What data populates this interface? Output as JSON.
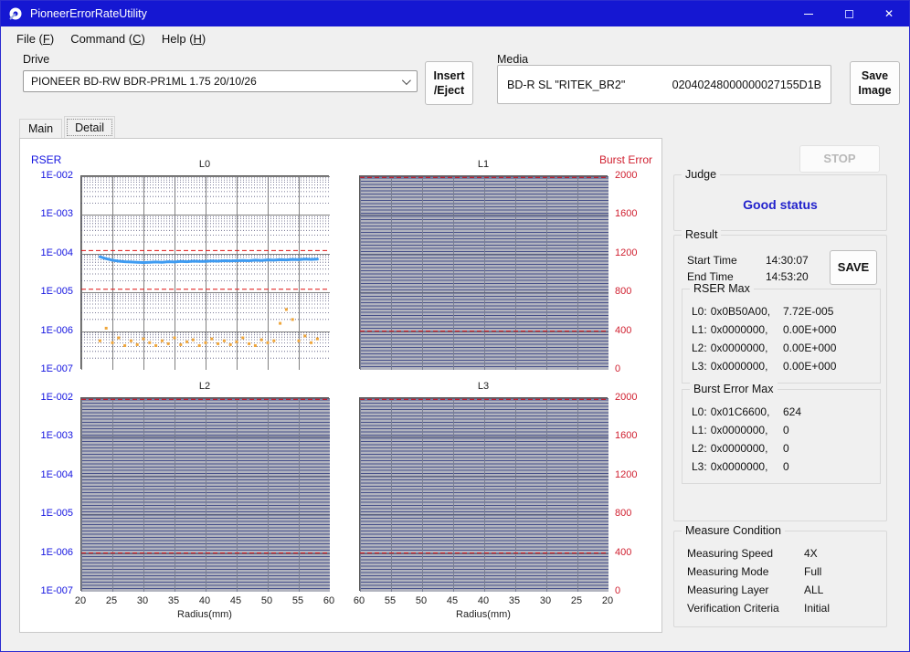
{
  "window": {
    "title": "PioneerErrorRateUtility"
  },
  "colors": {
    "titlebar": "#1517d2",
    "judge_status": "#2222cc",
    "axis_left": "#1414e0",
    "axis_right": "#d02030",
    "rser_line": "#3e9bf2",
    "burst_dots": "#efa63a",
    "threshold": "#e01010"
  },
  "menu": {
    "items": [
      {
        "pre": "File (",
        "key": "F",
        "post": ")"
      },
      {
        "pre": "Command (",
        "key": "C",
        "post": ")"
      },
      {
        "pre": "Help (",
        "key": "H",
        "post": ")"
      }
    ]
  },
  "drive": {
    "label": "Drive",
    "selected": "PIONEER BD-RW BDR-PR1ML 1.75 20/10/26"
  },
  "insert_eject": {
    "line1": "Insert",
    "line2": "/Eject"
  },
  "media": {
    "label": "Media",
    "disc": "BD-R SL \"RITEK_BR2\"",
    "id": "02040248000000027155D1B"
  },
  "save_image": {
    "line1": "Save",
    "line2": "Image"
  },
  "tabs": [
    {
      "label": "Main"
    },
    {
      "label": "Detail"
    }
  ],
  "stop_label": "STOP",
  "judge": {
    "label": "Judge",
    "status": "Good status"
  },
  "result": {
    "label": "Result",
    "start_time_label": "Start Time",
    "start_time": "14:30:07",
    "end_time_label": "End Time",
    "end_time": "14:53:20",
    "save_label": "SAVE",
    "rser_max": {
      "label": "RSER Max",
      "rows": [
        {
          "layer": "L0:",
          "address": "0x0B50A00,",
          "value": "7.72E-005"
        },
        {
          "layer": "L1:",
          "address": "0x0000000,",
          "value": "0.00E+000"
        },
        {
          "layer": "L2:",
          "address": "0x0000000,",
          "value": "0.00E+000"
        },
        {
          "layer": "L3:",
          "address": "0x0000000,",
          "value": "0.00E+000"
        }
      ]
    },
    "burst_error_max": {
      "label": "Burst Error Max",
      "rows": [
        {
          "layer": "L0:",
          "address": "0x01C6600,",
          "value": "624"
        },
        {
          "layer": "L1:",
          "address": "0x0000000,",
          "value": "0"
        },
        {
          "layer": "L2:",
          "address": "0x0000000,",
          "value": "0"
        },
        {
          "layer": "L3:",
          "address": "0x0000000,",
          "value": "0"
        }
      ]
    }
  },
  "measure_condition": {
    "label": "Measure Condition",
    "rows": [
      {
        "name": "Measuring Speed",
        "value": "4X"
      },
      {
        "name": "Measuring Mode",
        "value": "Full"
      },
      {
        "name": "Measuring Layer",
        "value": "ALL"
      },
      {
        "name": "Verification Criteria",
        "value": "Initial"
      }
    ]
  },
  "axes": {
    "left_title": "RSER",
    "right_title": "Burst Error",
    "left_ticks": [
      "1E-002",
      "1E-003",
      "1E-004",
      "1E-005",
      "1E-006",
      "1E-007"
    ],
    "right_ticks": [
      "2000",
      "1600",
      "1200",
      "800",
      "400",
      "0"
    ],
    "x_ticks_left": [
      "20",
      "25",
      "30",
      "35",
      "40",
      "45",
      "50",
      "55",
      "60"
    ],
    "x_ticks_right": [
      "60",
      "55",
      "50",
      "45",
      "40",
      "35",
      "30",
      "25",
      "20"
    ],
    "x_label": "Radius(mm)",
    "left_color": "#1414e0",
    "right_color": "#d02030"
  },
  "chart_data": [
    {
      "id": "L0",
      "title": "L0",
      "type": "line",
      "x_range": [
        20,
        60
      ],
      "x_direction": "normal",
      "left_axis": {
        "label": "RSER",
        "scale": "log",
        "min": 1e-07,
        "max": 0.01
      },
      "right_axis": {
        "label": "Burst Error",
        "scale": "linear",
        "min": 0,
        "max": 2000
      },
      "thresholds": [
        0.00012,
        1.2e-05
      ],
      "dense": false,
      "series": [
        {
          "name": "RSER",
          "axis": "left",
          "style": "line",
          "color": "#3e9bf2",
          "points": [
            [
              23,
              8.3e-05
            ],
            [
              24,
              7.4e-05
            ],
            [
              25,
              6.8e-05
            ],
            [
              26,
              6.4e-05
            ],
            [
              27,
              6.2e-05
            ],
            [
              28,
              6.1e-05
            ],
            [
              29,
              6e-05
            ],
            [
              30,
              5.9e-05
            ],
            [
              31,
              6e-05
            ],
            [
              32,
              6.1e-05
            ],
            [
              33,
              6e-05
            ],
            [
              34,
              6.2e-05
            ],
            [
              35,
              6.1e-05
            ],
            [
              36,
              6.3e-05
            ],
            [
              37,
              6.2e-05
            ],
            [
              38,
              6.4e-05
            ],
            [
              39,
              6.3e-05
            ],
            [
              40,
              6.3e-05
            ],
            [
              41,
              6.5e-05
            ],
            [
              42,
              6.4e-05
            ],
            [
              43,
              6.6e-05
            ],
            [
              44,
              6.5e-05
            ],
            [
              45,
              6.6e-05
            ],
            [
              46,
              6.7e-05
            ],
            [
              47,
              6.6e-05
            ],
            [
              48,
              6.8e-05
            ],
            [
              49,
              6.7e-05
            ],
            [
              50,
              6.9e-05
            ],
            [
              51,
              6.8e-05
            ],
            [
              52,
              7e-05
            ],
            [
              53,
              6.9e-05
            ],
            [
              54,
              7.1e-05
            ],
            [
              55,
              7e-05
            ],
            [
              56,
              7.2e-05
            ],
            [
              57,
              7.1e-05
            ],
            [
              58,
              7.2e-05
            ]
          ]
        },
        {
          "name": "Burst Error",
          "axis": "right",
          "style": "dots",
          "color": "#efa63a",
          "points": [
            [
              23,
              300
            ],
            [
              24,
              430
            ],
            [
              25,
              280
            ],
            [
              26,
              330
            ],
            [
              27,
              250
            ],
            [
              28,
              300
            ],
            [
              29,
              260
            ],
            [
              30,
              320
            ],
            [
              31,
              280
            ],
            [
              32,
              250
            ],
            [
              33,
              300
            ],
            [
              34,
              270
            ],
            [
              35,
              330
            ],
            [
              36,
              260
            ],
            [
              37,
              290
            ],
            [
              38,
              310
            ],
            [
              39,
              250
            ],
            [
              40,
              280
            ],
            [
              41,
              320
            ],
            [
              42,
              270
            ],
            [
              43,
              300
            ],
            [
              44,
              260
            ],
            [
              45,
              290
            ],
            [
              46,
              330
            ],
            [
              47,
              270
            ],
            [
              48,
              250
            ],
            [
              49,
              310
            ],
            [
              50,
              280
            ],
            [
              51,
              300
            ],
            [
              52,
              480
            ],
            [
              53,
              624
            ],
            [
              54,
              520
            ],
            [
              55,
              300
            ],
            [
              56,
              350
            ],
            [
              57,
              280
            ],
            [
              58,
              320
            ]
          ]
        }
      ]
    },
    {
      "id": "L1",
      "title": "L1",
      "type": "line",
      "x_range": [
        20,
        60
      ],
      "x_direction": "reversed",
      "left_axis": {
        "label": "RSER",
        "scale": "log",
        "min": 1e-07,
        "max": 0.01
      },
      "right_axis": {
        "label": "Burst Error",
        "scale": "linear",
        "min": 0,
        "max": 2000
      },
      "thresholds": [
        0.0093,
        1e-06
      ],
      "dense": true,
      "series": []
    },
    {
      "id": "L2",
      "title": "L2",
      "type": "line",
      "x_range": [
        20,
        60
      ],
      "x_direction": "normal",
      "left_axis": {
        "label": "RSER",
        "scale": "log",
        "min": 1e-07,
        "max": 0.01
      },
      "right_axis": {
        "label": "Burst Error",
        "scale": "linear",
        "min": 0,
        "max": 2000
      },
      "thresholds": [
        0.0093,
        1e-06
      ],
      "dense": true,
      "series": []
    },
    {
      "id": "L3",
      "title": "L3",
      "type": "line",
      "x_range": [
        20,
        60
      ],
      "x_direction": "reversed",
      "left_axis": {
        "label": "RSER",
        "scale": "log",
        "min": 1e-07,
        "max": 0.01
      },
      "right_axis": {
        "label": "Burst Error",
        "scale": "linear",
        "min": 0,
        "max": 2000
      },
      "thresholds": [
        0.0093,
        1e-06
      ],
      "dense": true,
      "series": []
    }
  ]
}
